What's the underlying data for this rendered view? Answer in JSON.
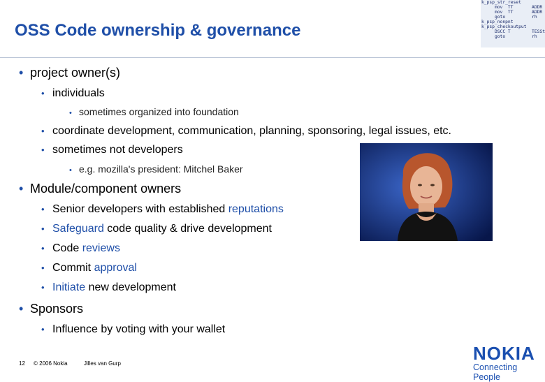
{
  "title": "OSS Code ownership & governance",
  "bullet_glyph": "•",
  "code_snippet": [
    "k_psp_str_reset",
    "     mov  TT       ADDR VI",
    "     mov  TT       ADDR VI",
    "     goto          rh",
    "k_psp_nonpnt",
    "",
    "k_psp_checkoutput",
    "     DSCC T        TESSt(",
    "     goto          rh"
  ],
  "bullets": {
    "b1": "project owner(s)",
    "b1a": "individuals",
    "b1a1": "sometimes organized into foundation",
    "b1b": "coordinate development, communication, planning, sponsoring, legal issues, etc.",
    "b1c": "sometimes not developers",
    "b1c1": "e.g. mozilla's president: Mitchel Baker",
    "b2": "Module/component owners",
    "b2a_pre": "Senior developers with established ",
    "b2a_hl": "reputations",
    "b2b_hl": "Safeguard",
    "b2b_post": " code quality & drive development",
    "b2c_pre": "Code ",
    "b2c_hl": "reviews",
    "b2d_pre": "Commit ",
    "b2d_hl": "approval",
    "b2e_hl": "Initiate",
    "b2e_post": " new development",
    "b3": "Sponsors",
    "b3a": "Influence by voting with your wallet"
  },
  "footer": {
    "page": "12",
    "copyright": "© 2006 Nokia",
    "author": "Jilles van Gurp"
  },
  "logo": {
    "name": "NOKIA",
    "tagline": "Connecting People"
  }
}
